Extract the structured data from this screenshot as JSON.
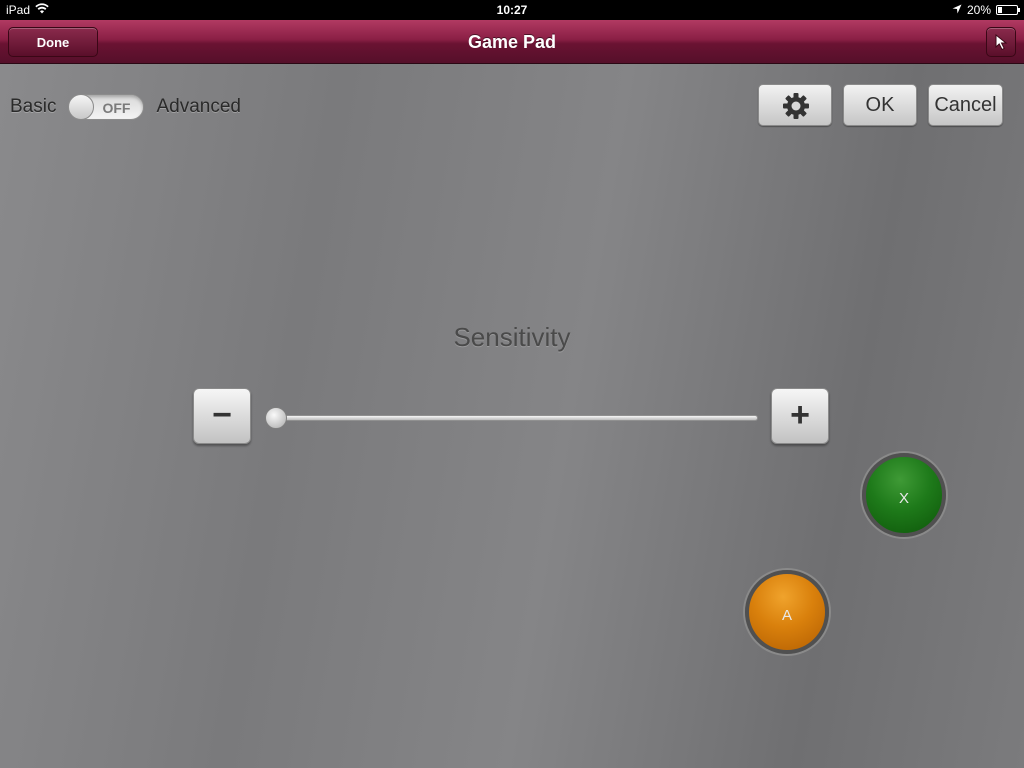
{
  "status_bar": {
    "device": "iPad",
    "time": "10:27",
    "battery": "20%",
    "battery_level": 0.2
  },
  "nav_bar": {
    "done_label": "Done",
    "title": "Game Pad"
  },
  "mode": {
    "left_label": "Basic",
    "toggle_state": "OFF",
    "right_label": "Advanced"
  },
  "actions": {
    "ok_label": "OK",
    "cancel_label": "Cancel"
  },
  "sensitivity": {
    "label": "Sensitivity",
    "minus_label": "−",
    "plus_label": "+",
    "value": 0.0
  },
  "gamepad": {
    "x_label": "X",
    "a_label": "A",
    "colors": {
      "x": "#1e7a1a",
      "a": "#d9800c"
    }
  },
  "colors": {
    "nav_accent": "#8a1f45",
    "background": "#7a7a7c"
  }
}
